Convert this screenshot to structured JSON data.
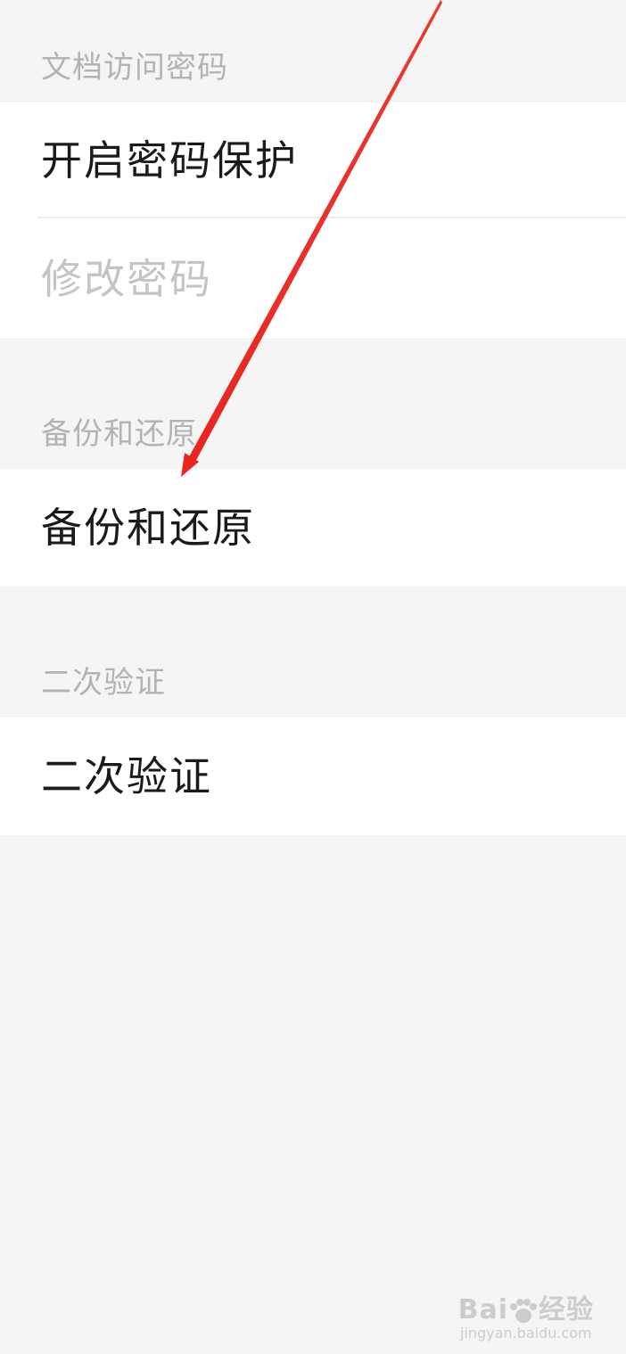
{
  "sections": [
    {
      "header": "文档访问密码",
      "items": [
        {
          "label": "开启密码保护",
          "enabled": true
        },
        {
          "label": "修改密码",
          "enabled": false
        }
      ]
    },
    {
      "header": "备份和还原",
      "items": [
        {
          "label": "备份和还原",
          "enabled": true
        }
      ]
    },
    {
      "header": "二次验证",
      "items": [
        {
          "label": "二次验证",
          "enabled": true
        }
      ]
    }
  ],
  "annotation": {
    "type": "arrow",
    "color": "#e8251f",
    "target": "备份和还原"
  },
  "watermark": {
    "logo_text_left": "Bai",
    "logo_text_right": "经验",
    "url": "jingyan.baidu.com"
  }
}
